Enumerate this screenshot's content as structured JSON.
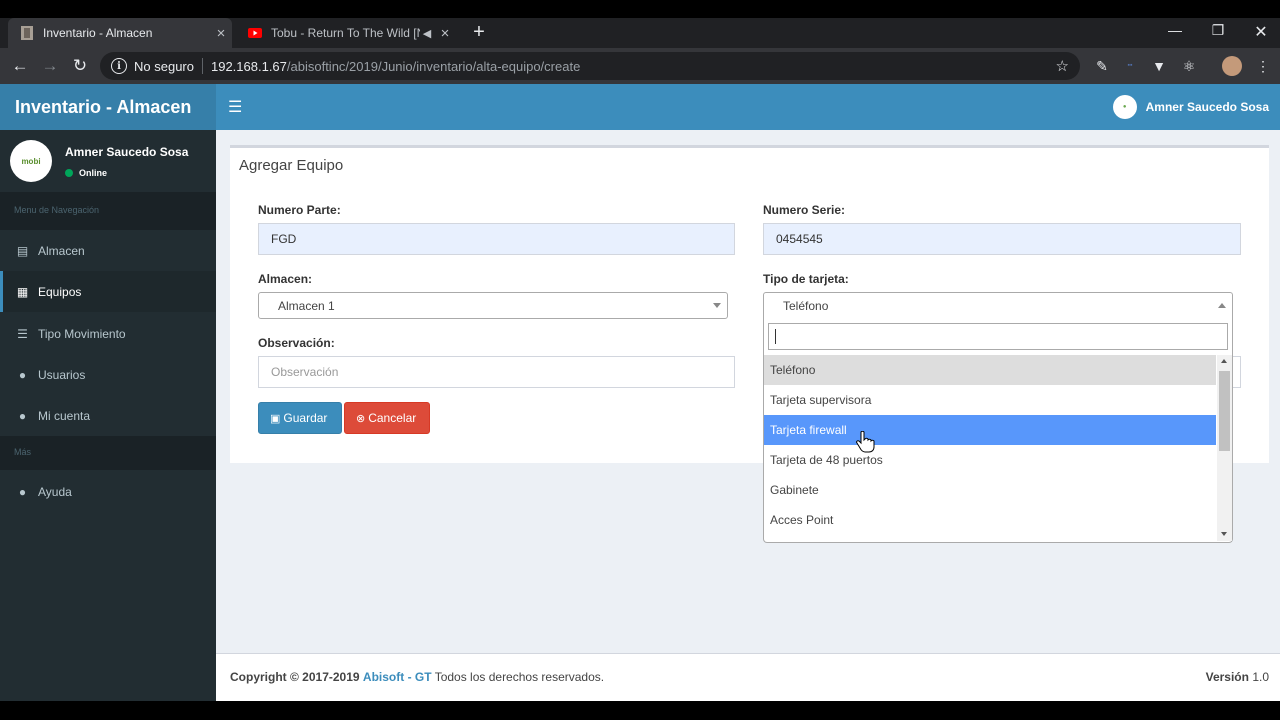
{
  "browser": {
    "tabs": [
      {
        "title": "Inventario - Almacen"
      },
      {
        "title": "Tobu - Return To The Wild [N"
      }
    ],
    "address": {
      "security_label": "No seguro",
      "host": "192.168.1.67",
      "path": "/abisoftinc/2019/Junio/inventario/alta-equipo/create"
    }
  },
  "app": {
    "logo": "Inventario - Almacen",
    "navbar_user": "Amner Saucedo Sosa"
  },
  "sidebar": {
    "user_name": "Amner Saucedo Sosa",
    "user_status": "Online",
    "avatar_text": "mobi",
    "nav_header": "Menu de Navegación",
    "items": [
      {
        "label": "Almacen",
        "icon": "book-icon"
      },
      {
        "label": "Equipos",
        "icon": "grid-icon"
      },
      {
        "label": "Tipo Movimiento",
        "icon": "list-icon"
      },
      {
        "label": "Usuarios",
        "icon": "users-icon"
      },
      {
        "label": "Mi cuenta",
        "icon": "user-icon"
      }
    ],
    "more_header": "Más",
    "help_label": "Ayuda"
  },
  "form": {
    "title": "Agregar Equipo",
    "numero_parte_label": "Numero Parte:",
    "numero_parte_value": "FGD",
    "numero_serie_label": "Numero Serie:",
    "numero_serie_value": "0454545",
    "almacen_label": "Almacen:",
    "almacen_value": "Almacen 1",
    "tipo_tarjeta_label": "Tipo de tarjeta:",
    "tipo_tarjeta_value": "Teléfono",
    "observacion_label": "Observación:",
    "observacion_placeholder": "Observación",
    "save_label": "Guardar",
    "cancel_label": "Cancelar"
  },
  "dropdown": {
    "options": [
      "Teléfono",
      "Tarjeta supervisora",
      "Tarjeta firewall",
      "Tarjeta de 48 puertos",
      "Gabinete",
      "Acces Point"
    ],
    "selected_index": 0,
    "highlighted_index": 2
  },
  "footer": {
    "copyright": "Copyright © 2017-2019",
    "company": "Abisoft - GT",
    "rights": "Todos los derechos reservados.",
    "version_label": "Versión",
    "version_value": "1.0"
  },
  "colors": {
    "navbar": "#3c8dbc",
    "logo_bg": "#367fa9",
    "sidebar_bg": "#222d32",
    "highlight": "#5897fb",
    "danger": "#dd4b39"
  }
}
